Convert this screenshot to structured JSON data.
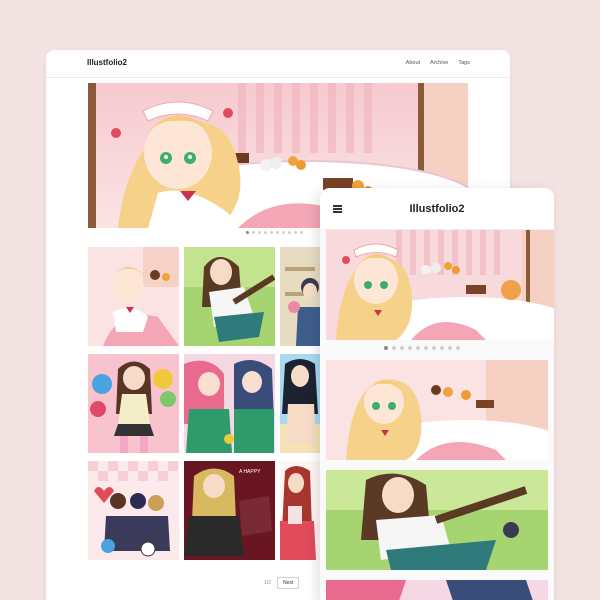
{
  "desktop": {
    "site_title": "Illustfolio2",
    "nav": [
      {
        "label": "About"
      },
      {
        "label": "Archive"
      },
      {
        "label": "Tags"
      }
    ],
    "hero_dot_count": 10,
    "hero_active_dot": 0,
    "pagination": {
      "page_label": "1/2",
      "next_label": "Next"
    }
  },
  "mobile": {
    "site_title": "Illustfolio2",
    "menu_icon": "hamburger-menu-icon",
    "hero_dot_count": 10,
    "hero_active_dot": 0
  },
  "colors": {
    "background": "#f3e3e3",
    "window": "#ffffff",
    "accent_pink": "#f4a6b6",
    "accent_green": "#8fd14f"
  }
}
